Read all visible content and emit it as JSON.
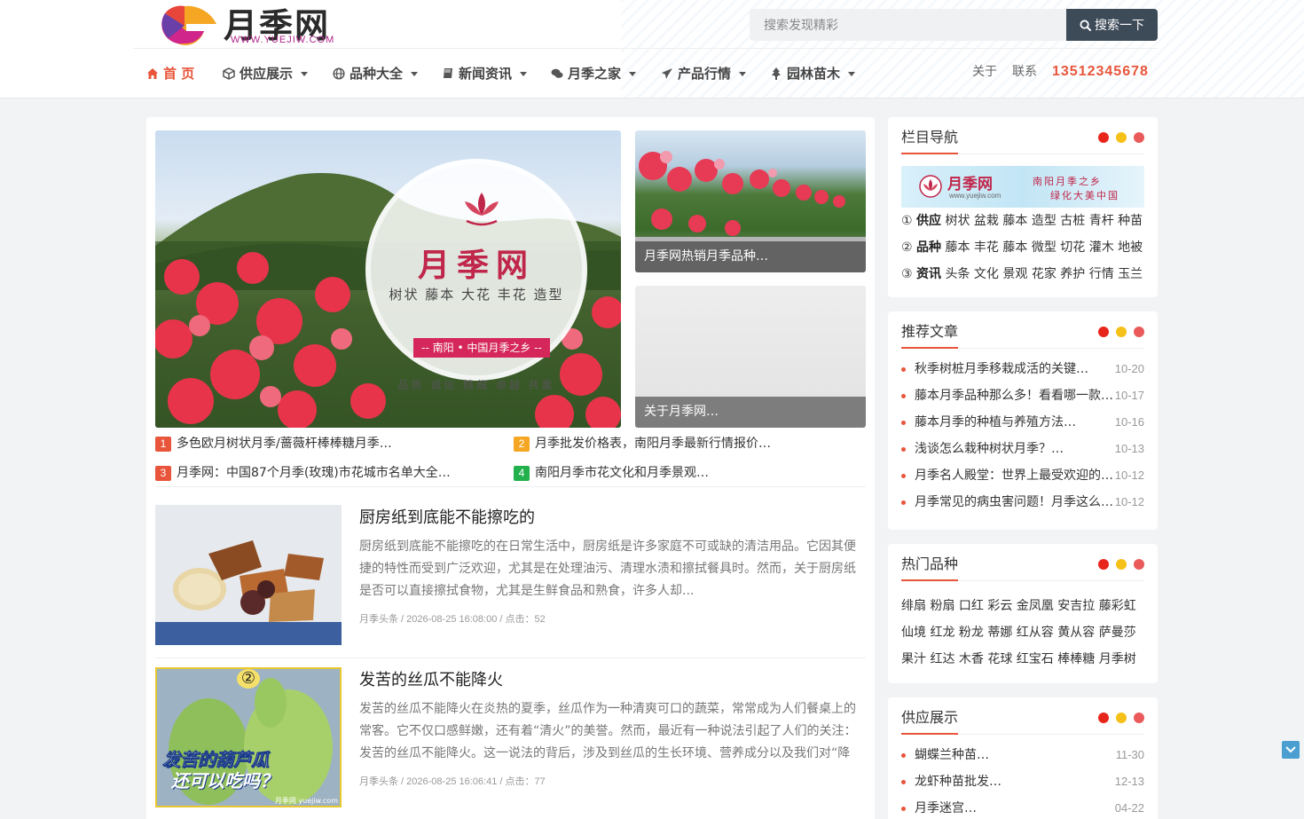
{
  "logo": {
    "text": "月季网",
    "url": "WWW.YUEJIW.COM"
  },
  "search": {
    "placeholder": "搜索发现精彩",
    "button": "搜索一下"
  },
  "nav": {
    "items": [
      {
        "label": "首 页",
        "icon": "home-icon"
      },
      {
        "label": "供应展示",
        "icon": "cube-icon"
      },
      {
        "label": "品种大全",
        "icon": "globe-icon"
      },
      {
        "label": "新闻资讯",
        "icon": "book-icon"
      },
      {
        "label": "月季之家",
        "icon": "comments-icon"
      },
      {
        "label": "产品行情",
        "icon": "paper-plane-icon"
      },
      {
        "label": "园林苗木",
        "icon": "tree-icon"
      }
    ],
    "about": "关于",
    "contact": "联系",
    "phone": "13512345678"
  },
  "slider": {
    "badge_title": "月季网",
    "badge_sub": "树状 藤本 大花 丰花 造型",
    "badge_red": "-- 南阳 • 中国月季之乡 --",
    "badge_foot": "品质 诚信 精细 卓越 共赢"
  },
  "side_pics": [
    {
      "caption": "月季网热销月季品种…"
    },
    {
      "caption": "关于月季网…"
    }
  ],
  "hot": [
    {
      "num": "1",
      "title": "多色欧月树状月季/蔷薇杆棒棒糖月季…",
      "color": "#e8553b"
    },
    {
      "num": "2",
      "title": "月季批发价格表，南阳月季最新行情报价…",
      "color": "#f5a623"
    },
    {
      "num": "3",
      "title": "月季网：中国87个月季(玫瑰)市花城市名单大全…",
      "color": "#e8553b"
    },
    {
      "num": "4",
      "title": "南阳月季市花文化和月季景观…",
      "color": "#22b14c"
    }
  ],
  "articles": [
    {
      "title": "厨房纸到底能不能擦吃的",
      "desc": "厨房纸到底能不能擦吃的在日常生活中，厨房纸是许多家庭不可或缺的清洁用品。它因其便捷的特性而受到广泛欢迎，尤其是在处理油污、清理水渍和擦拭餐具时。然而，关于厨房纸是否可以直接擦拭食物，尤其是生鲜食品和熟食，许多人却...",
      "meta": "月季头条 / 2026-08-25 16:08:00 / 点击：52"
    },
    {
      "title": "发苦的丝瓜不能降火",
      "desc": "发苦的丝瓜不能降火在炎热的夏季，丝瓜作为一种清爽可口的蔬菜，常常成为人们餐桌上的常客。它不仅口感鲜嫩，还有着“清火”的美誉。然而，最近有一种说法引起了人们的关注：发苦的丝瓜不能降火。这一说法的背后，涉及到丝瓜的生长环境、营养成分以及我们对“降火”...",
      "meta": "月季头条 / 2026-08-25 16:06:41 / 点击：77",
      "thumb_line1": "发苦的葫芦瓜",
      "thumb_line2": "还可以吃吗？",
      "thumb_badge": "②",
      "thumb_mark": "月季网 yuejiw.com"
    }
  ],
  "widgets": {
    "nav_title": "栏目导航",
    "banner_text": "月季网",
    "banner_url": "www.yuejiw.com",
    "banner_slogan1": "南阳月季之乡",
    "banner_slogan2": "绿化大美中国",
    "cats": [
      {
        "num": "①",
        "name": "供应",
        "tags": "树状 盆栽 藤本 造型 古桩 青杆 种苗 蔷薇"
      },
      {
        "num": "②",
        "name": "品种",
        "tags": "藤本 丰花 藤本 微型 切花 灌木 地被 古老"
      },
      {
        "num": "③",
        "name": "资讯",
        "tags": "头条 文化 景观 花家 养护 行情 玉兰 百科"
      }
    ],
    "rec_title": "推荐文章",
    "rec": [
      {
        "title": "秋季树桩月季移栽成活的关键…",
        "date": "10-20"
      },
      {
        "title": "藤本月季品种那么多！看看哪一款…",
        "date": "10-17"
      },
      {
        "title": "藤本月季的种植与养殖方法…",
        "date": "10-16"
      },
      {
        "title": "浅谈怎么栽种树状月季？…",
        "date": "10-13"
      },
      {
        "title": "月季名人殿堂：世界上最受欢迎的…",
        "date": "10-12"
      },
      {
        "title": "月季常见的病虫害问题！月季这么…",
        "date": "10-12"
      }
    ],
    "hot_title": "热门品种",
    "hot_rows": [
      "绯扇 粉扇 口红 彩云 金凤凰 安吉拉 藤彩虹",
      "仙境 红龙 粉龙 蒂娜 红从容 黄从容 萨曼莎",
      "果汁 红达 木香 花球 红宝石 棒棒糖 月季树"
    ],
    "supply_title": "供应展示",
    "supply": [
      {
        "title": "蝴蝶兰种苗…",
        "date": "11-30"
      },
      {
        "title": "龙虾种苗批发…",
        "date": "12-13"
      },
      {
        "title": "月季迷宫…",
        "date": "04-22"
      }
    ]
  },
  "colors": {
    "accent": "#e8553b",
    "dot_red": "#e8251b",
    "dot_yellow": "#f5c018",
    "dot_pink": "#ea5a5a",
    "search_btn": "#3d4a57"
  }
}
